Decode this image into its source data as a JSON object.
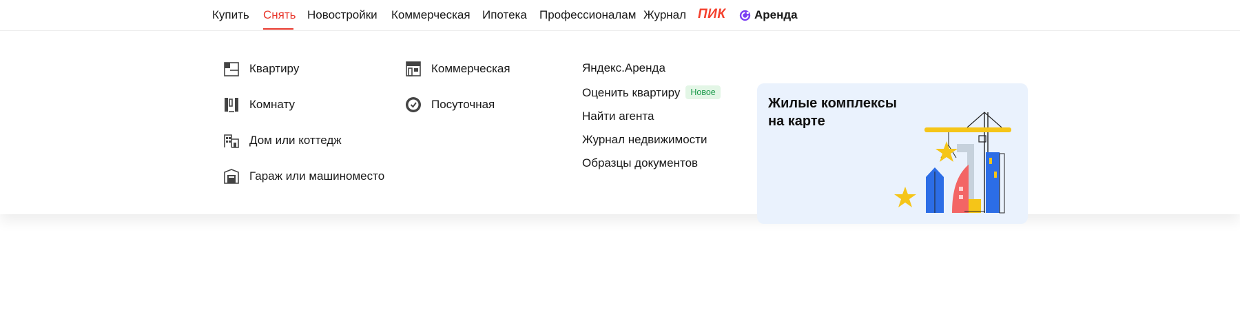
{
  "nav": {
    "items": [
      "Купить",
      "Снять",
      "Новостройки",
      "Коммерческая",
      "Ипотека",
      "Профессионалам",
      "Журнал"
    ],
    "active": "Снять",
    "pik": "ПИК",
    "arenda": "Аренда"
  },
  "menu": {
    "col1": [
      "Квартиру",
      "Комнату",
      "Дом или коттедж",
      "Гараж или машиноместо"
    ],
    "col2": [
      "Коммерческая",
      "Посуточная"
    ],
    "links": [
      "Яндекс.Аренда",
      "Оценить квартиру",
      "Найти агента",
      "Журнал недвижимости",
      "Образцы документов"
    ],
    "badge_new": "Новое"
  },
  "promo": {
    "title": "Жилые комплексы на карте"
  },
  "colors": {
    "accent": "#e8382d",
    "pik": "#f4412e",
    "badge_text": "#1a9a4a",
    "badge_bg": "#e3f6e6",
    "promo_bg": "#eaf2fd"
  }
}
